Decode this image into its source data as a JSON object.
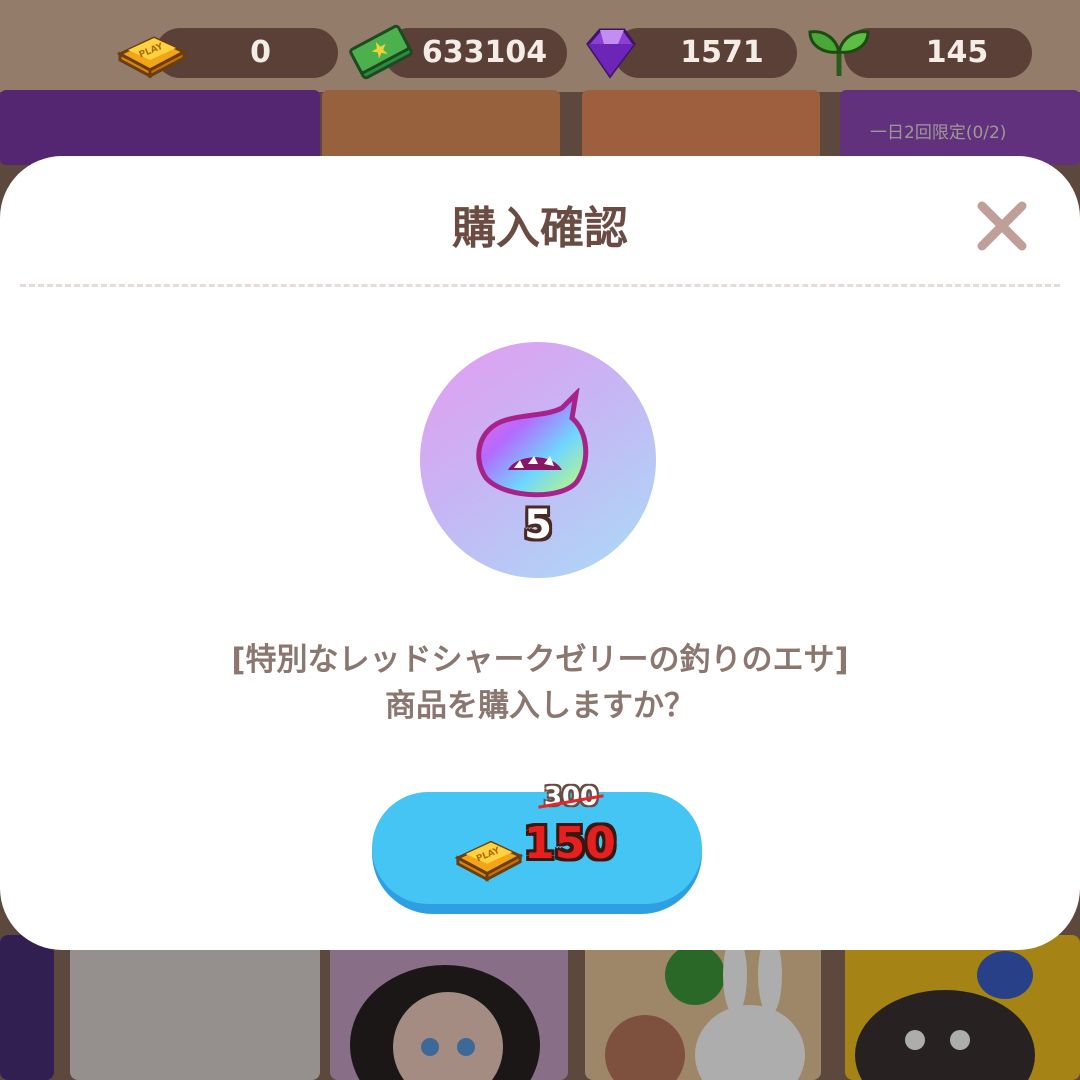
{
  "currencies": [
    {
      "icon": "gold-play-bar-icon",
      "value": "0"
    },
    {
      "icon": "cash-bundle-icon",
      "value": "633104"
    },
    {
      "icon": "purple-gem-icon",
      "value": "1571"
    },
    {
      "icon": "sprout-icon",
      "value": "145"
    }
  ],
  "background": {
    "limit_label": "一日2回限定(0/2)"
  },
  "modal": {
    "title": "購入確認",
    "item": {
      "icon": "rainbow-shark-jelly-icon",
      "count": "5"
    },
    "message_line1": "[特別なレッドシャークゼリーの釣りのエサ]",
    "message_line2": "商品を購入しますか？",
    "buy_button": {
      "currency_icon": "gold-play-bar-icon",
      "original_price": "300",
      "price": "150"
    }
  },
  "colors": {
    "title": "#6b4c43",
    "message": "#8b7770",
    "button": "#44c5f3",
    "sale_price": "#e6201f"
  }
}
